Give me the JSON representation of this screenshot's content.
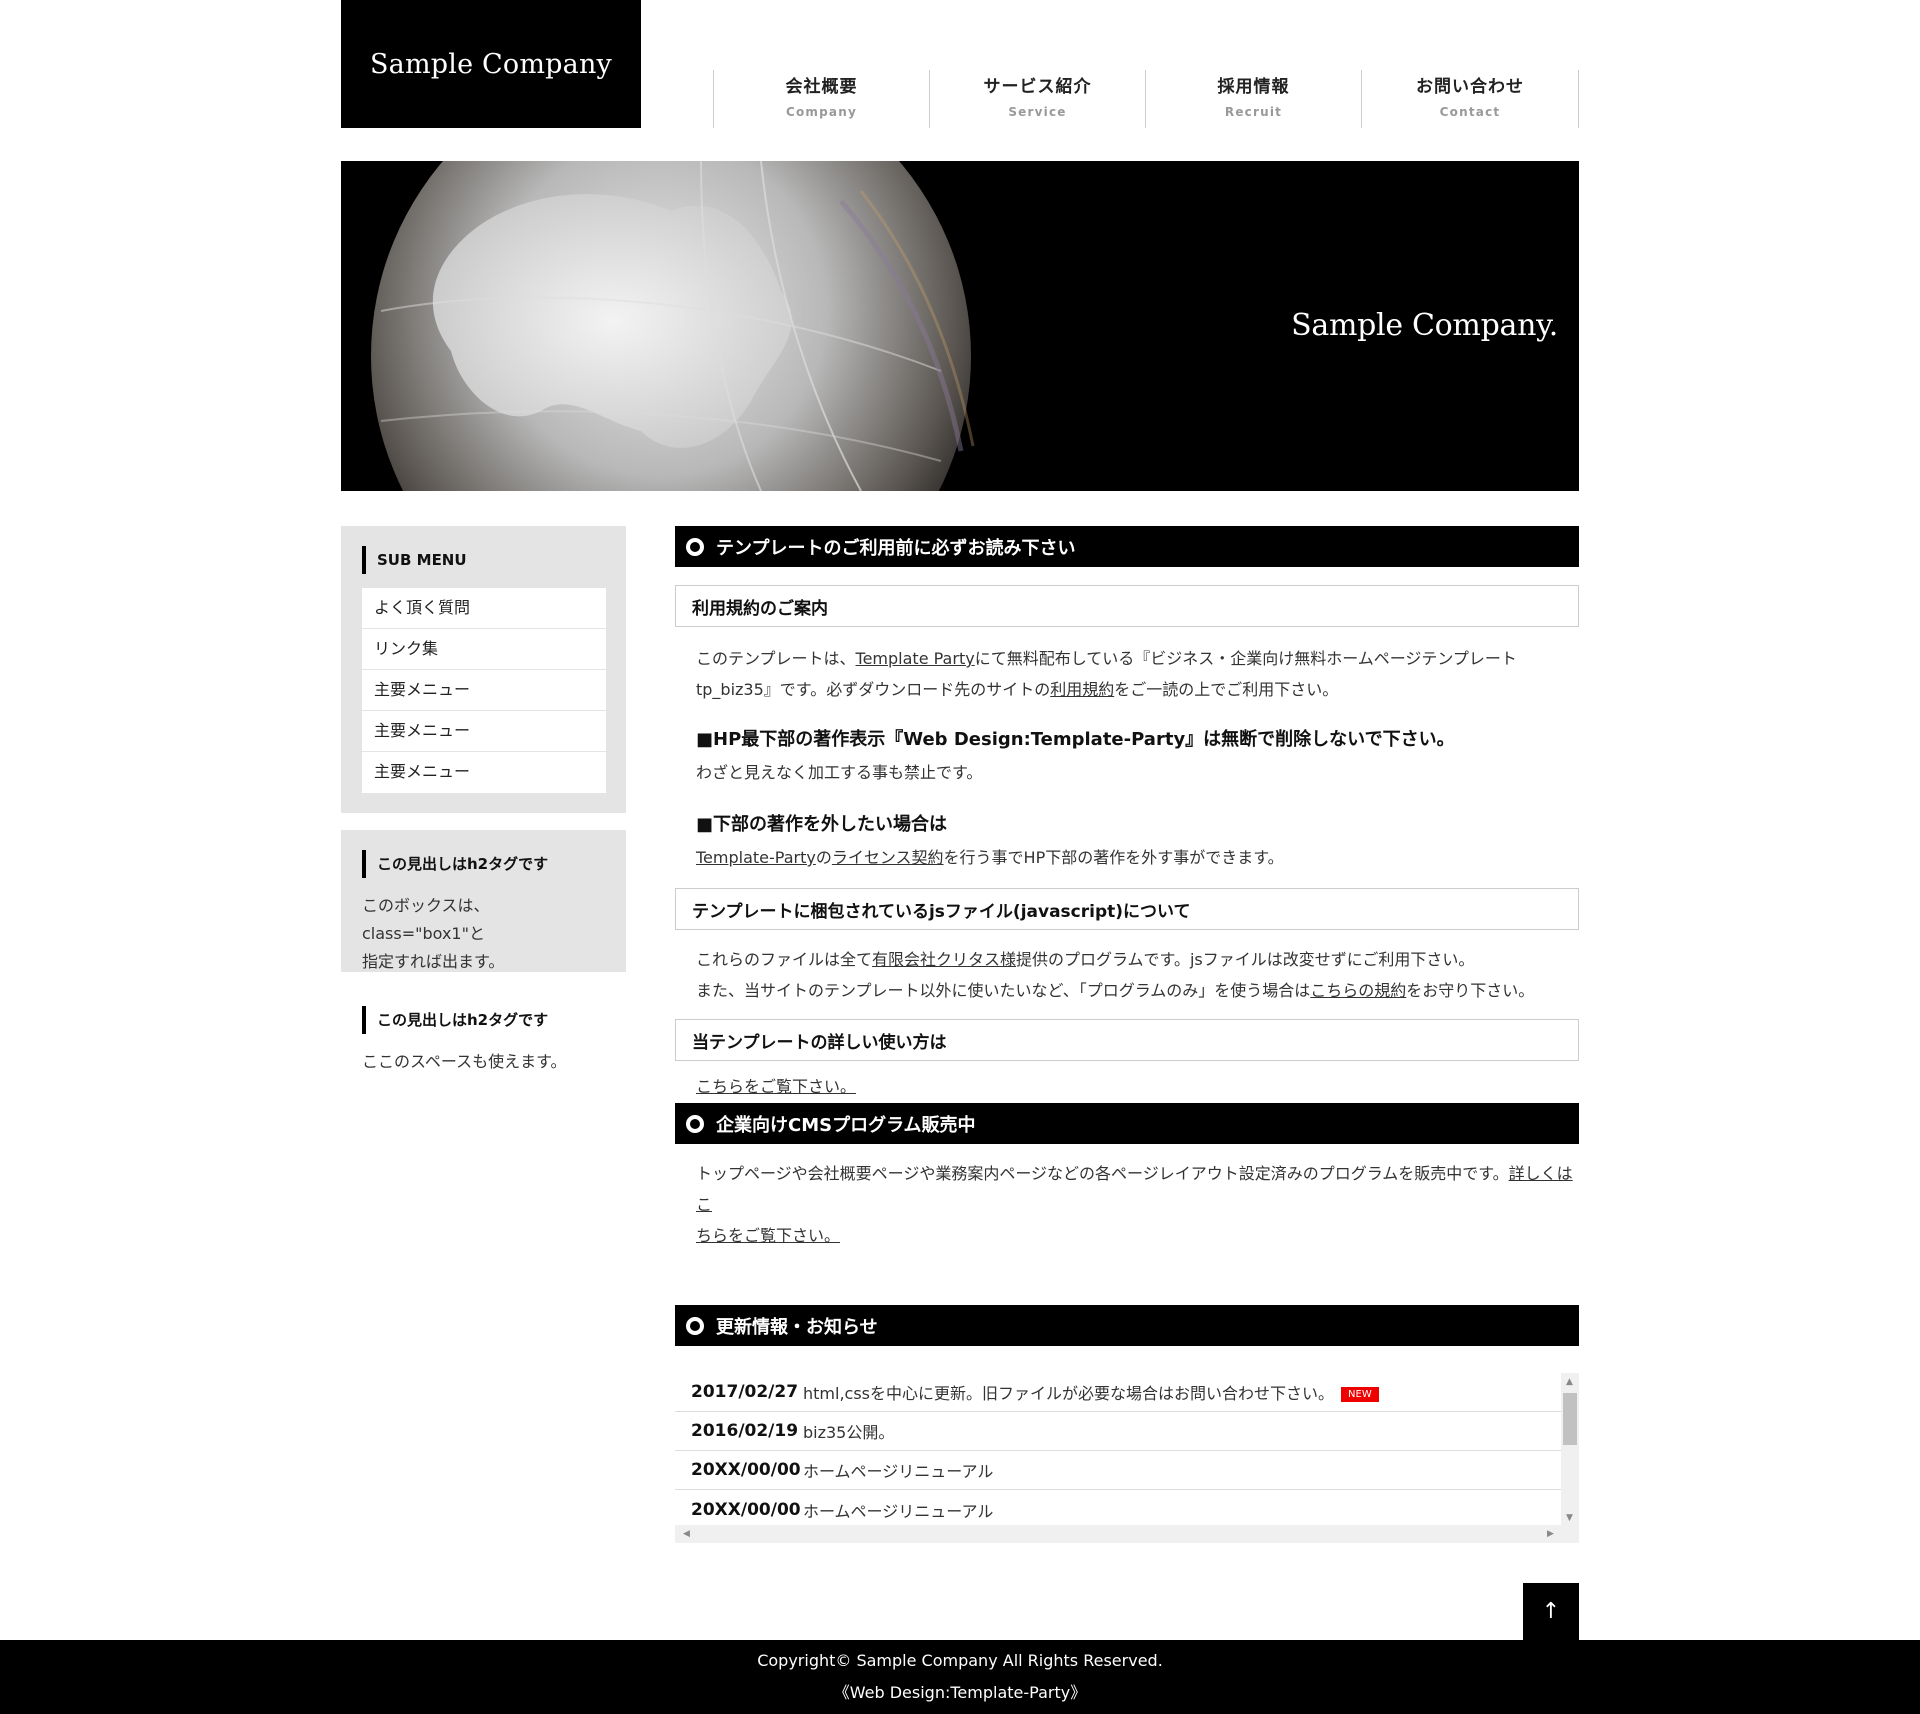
{
  "header": {
    "logo": "Sample Company",
    "nav": [
      {
        "jp": "会社概要",
        "en": "Company"
      },
      {
        "jp": "サービス紹介",
        "en": "Service"
      },
      {
        "jp": "採用情報",
        "en": "Recruit"
      },
      {
        "jp": "お問い合わせ",
        "en": "Contact"
      }
    ]
  },
  "hero": {
    "text": "Sample Company."
  },
  "sidebar": {
    "submenu_title": "SUB MENU",
    "submenu_items": [
      "よく頂く質問",
      "リンク集",
      "主要メニュー",
      "主要メニュー",
      "主要メニュー"
    ],
    "box1_title": "この見出しはh2タグです",
    "box1_text_1": "このボックスは、class=\"box1\"と",
    "box1_text_2": "指定すれば出ます。",
    "plain_title": "この見出しはh2タグです",
    "plain_text": "ここのスペースも使えます。"
  },
  "main": {
    "section1_title": "テンプレートのご利用前に必ずお読み下さい",
    "terms_title": "利用規約のご案内",
    "terms_p1_a": "このテンプレートは、",
    "terms_p1_link": "Template Party",
    "terms_p1_b": "にて無料配布している『ビジネス・企業向け無料ホームページテンプレート",
    "terms_p2_a": "tp_biz35』です。必ずダウンロード先のサイトの",
    "terms_p2_link": "利用規約",
    "terms_p2_b": "をご一読の上でご利用下さい。",
    "h4_1": "■HP最下部の著作表示『Web Design:Template-Party』は無断で削除しないで下さい。",
    "h4_1_text": "わざと見えなく加工する事も禁止です。",
    "h4_2": "■下部の著作を外したい場合は",
    "h4_2_link1": "Template-Party",
    "h4_2_mid": "の",
    "h4_2_link2": "ライセンス契約",
    "h4_2_end": "を行う事でHP下部の著作を外す事ができます。",
    "js_title": "テンプレートに梱包されているjsファイル(javascript)について",
    "js_p1_a": "これらのファイルは全て",
    "js_p1_link": "有限会社クリタス様",
    "js_p1_b": "提供のプログラムです。jsファイルは改変せずにご利用下さい。",
    "js_p2_a": "また、当サイトのテンプレート以外に使いたいなど、「プログラムのみ」を使う場合は",
    "js_p2_link": "こちらの規約",
    "js_p2_b": "をお守り下さい。",
    "usage_title": "当テンプレートの詳しい使い方は",
    "usage_link": "こちらをご覧下さい。",
    "section2_title": "企業向けCMSプログラム販売中",
    "cms_p1_a": "トップページや会社概要ページや業務案内ページなどの各ページレイアウト設定済みのプログラムを販売中です。",
    "cms_p1_link": "詳しくはこ",
    "cms_p2_link": "ちらをご覧下さい。",
    "section3_title": "更新情報・お知らせ",
    "news": [
      {
        "date": "2017/02/27",
        "text": "html,cssを中心に更新。旧ファイルが必要な場合はお問い合わせ下さい。",
        "badge": "NEW"
      },
      {
        "date": "2016/02/19",
        "text": "biz35公開。",
        "badge": ""
      },
      {
        "date": "20XX/00/00",
        "text": "ホームページリニューアル",
        "badge": ""
      },
      {
        "date": "20XX/00/00",
        "text": "ホームページリニューアル",
        "badge": ""
      }
    ]
  },
  "pagetop": "↑",
  "footer": {
    "copyright": "Copyright© Sample Company All Rights Reserved.",
    "credit": "《Web Design:Template-Party》"
  },
  "colors": {
    "bar": "#000000",
    "badge": "#ee0000",
    "sidebar_bg": "#e4e4e4"
  }
}
